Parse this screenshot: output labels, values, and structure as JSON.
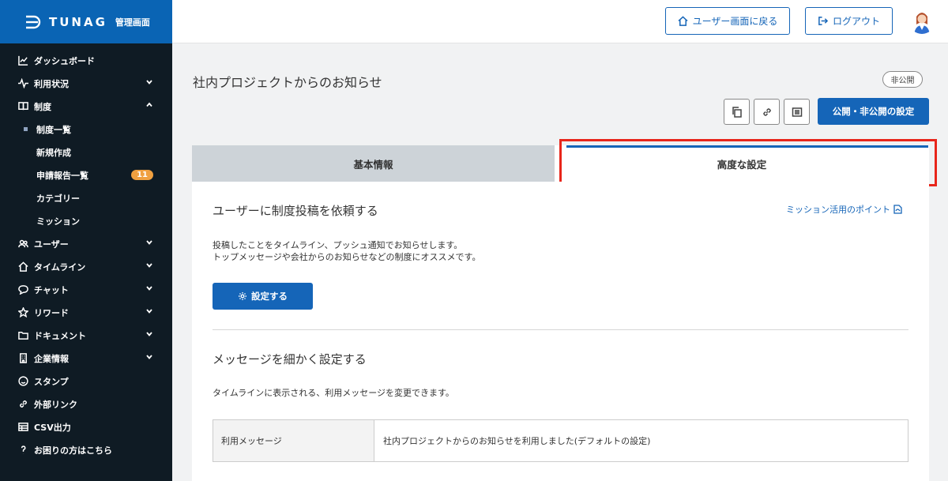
{
  "brand": {
    "name": "TUNAG",
    "sub": "管理画面"
  },
  "sidebar": {
    "items": [
      {
        "label": "ダッシュボード",
        "icon": "chart-line-icon",
        "chevron": ""
      },
      {
        "label": "利用状況",
        "icon": "pulse-icon",
        "chevron": "down"
      },
      {
        "label": "制度",
        "icon": "book-icon",
        "chevron": "up"
      },
      {
        "label": "ユーザー",
        "icon": "users-icon",
        "chevron": "down"
      },
      {
        "label": "タイムライン",
        "icon": "home-icon",
        "chevron": "down"
      },
      {
        "label": "チャット",
        "icon": "chat-icon",
        "chevron": "down"
      },
      {
        "label": "リワード",
        "icon": "star-icon",
        "chevron": "down"
      },
      {
        "label": "ドキュメント",
        "icon": "folder-icon",
        "chevron": "down"
      },
      {
        "label": "企業情報",
        "icon": "building-icon",
        "chevron": "down"
      },
      {
        "label": "スタンプ",
        "icon": "smile-icon",
        "chevron": ""
      },
      {
        "label": "外部リンク",
        "icon": "link-icon",
        "chevron": ""
      },
      {
        "label": "CSV出力",
        "icon": "table-icon",
        "chevron": ""
      },
      {
        "label": "お困りの方はこちら",
        "icon": "help-icon",
        "chevron": ""
      }
    ],
    "sub_items": [
      {
        "label": "制度一覧",
        "active": true
      },
      {
        "label": "新規作成"
      },
      {
        "label": "申請報告一覧",
        "badge": "11"
      },
      {
        "label": "カテゴリー"
      },
      {
        "label": "ミッション"
      }
    ]
  },
  "header": {
    "back_label": "ユーザー画面に戻る",
    "logout_label": "ログアウト"
  },
  "page": {
    "title": "社内プロジェクトからのお知らせ",
    "status": "非公開",
    "publish_label": "公開・非公開の設定"
  },
  "tabs": {
    "basic": "基本情報",
    "advanced": "高度な設定"
  },
  "section1": {
    "title": "ユーザーに制度投稿を依頼する",
    "link": "ミッション活用のポイント",
    "desc_line1": "投稿したことをタイムライン、プッシュ通知でお知らせします。",
    "desc_line2": "トップメッセージや会社からのお知らせなどの制度にオススメです。",
    "button": "設定する"
  },
  "section2": {
    "title": "メッセージを細かく設定する",
    "desc": "タイムラインに表示される、利用メッセージを変更できます。",
    "table": {
      "header": "利用メッセージ",
      "value": "社内プロジェクトからのお知らせを利用しました(デフォルトの設定)"
    }
  },
  "colors": {
    "brand": "#0a64b4",
    "sidebar": "#0f1b24",
    "accent": "#1565b8",
    "highlight": "#e8261b",
    "badge": "#f0a040"
  }
}
